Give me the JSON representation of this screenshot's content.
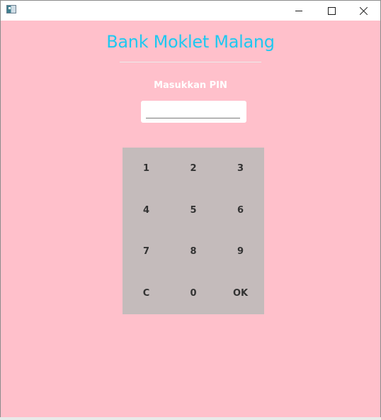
{
  "window": {
    "title": "",
    "icon": "app-window-icon",
    "controls": [
      "minimize-icon",
      "maximize-icon",
      "close-icon"
    ]
  },
  "app": {
    "title": "Bank Moklet Malang",
    "pin_label": "Masukkan PIN",
    "pin_value": ""
  },
  "keypad": {
    "keys": [
      "1",
      "2",
      "3",
      "4",
      "5",
      "6",
      "7",
      "8",
      "9",
      "C",
      "0",
      "OK"
    ]
  },
  "colors": {
    "background": "#ffc0cb",
    "title": "#1ec8f0",
    "keypad": "#c4bbbb",
    "key_text": "#333333",
    "label": "#ffffff"
  }
}
